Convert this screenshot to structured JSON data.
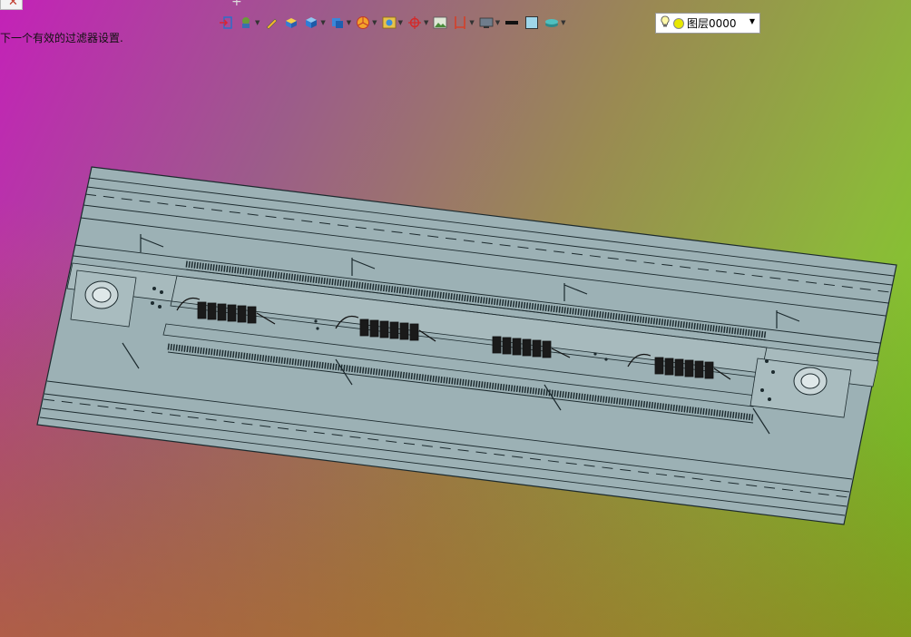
{
  "status_text": "下一个有效的过滤器设置.",
  "tab_close_glyph": "✕",
  "tab_add_glyph": "+",
  "toolbar": {
    "icons": [
      "exit-icon",
      "render-icon",
      "pencil-icon",
      "solid-box-icon",
      "cube-icon",
      "view-cube-icon",
      "pie-icon",
      "camera-icon",
      "crosshair-icon",
      "image-icon",
      "frame-icon",
      "monitor-icon",
      "line-weight-icon",
      "color-fill-icon",
      "layer-stack-icon"
    ],
    "layer": {
      "name": "图层0000",
      "dropdown_glyph": "▼"
    }
  },
  "colors": {
    "model_fill": "#9cb1b5",
    "model_stroke": "#1c2a2e",
    "layer_dot": "#e8e800"
  }
}
